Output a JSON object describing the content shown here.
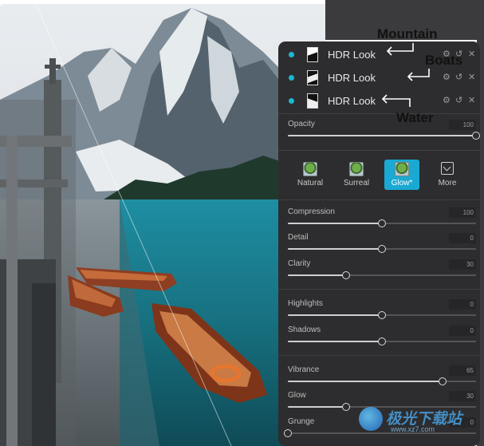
{
  "layers": [
    {
      "name": "HDR Look",
      "annotation": "Mountain"
    },
    {
      "name": "HDR Look",
      "annotation": "Boats"
    },
    {
      "name": "HDR Look",
      "annotation": "Water"
    }
  ],
  "opacity": {
    "label": "Opacity",
    "value": "100",
    "level": 1.0
  },
  "presets": [
    {
      "label": "Natural",
      "icon": "natural-preset-icon",
      "active": false
    },
    {
      "label": "Surreal",
      "icon": "surreal-preset-icon",
      "active": false
    },
    {
      "label": "Glow*",
      "icon": "glow-preset-icon",
      "active": true
    },
    {
      "label": "More",
      "icon": "more-presets-icon",
      "active": false
    }
  ],
  "sliders": [
    {
      "label": "Compression",
      "value": "100",
      "level": 0.5
    },
    {
      "label": "Detail",
      "value": "0",
      "level": 0.5
    },
    {
      "label": "Clarity",
      "value": "30",
      "level": 0.31
    },
    {
      "label": "Highlights",
      "value": "0",
      "level": 0.5
    },
    {
      "label": "Shadows",
      "value": "0",
      "level": 0.5
    },
    {
      "label": "Vibrance",
      "value": "65",
      "level": 0.82
    },
    {
      "label": "Glow",
      "value": "30",
      "level": 0.31
    },
    {
      "label": "Grunge",
      "value": "0",
      "level": 0.0
    }
  ],
  "colors": {
    "accent": "#1aa9d3",
    "panel": "#2d2d2f",
    "dot": "#19b9d1"
  },
  "watermark": {
    "brand": "极光下载站",
    "url": "www.xz7.com"
  }
}
